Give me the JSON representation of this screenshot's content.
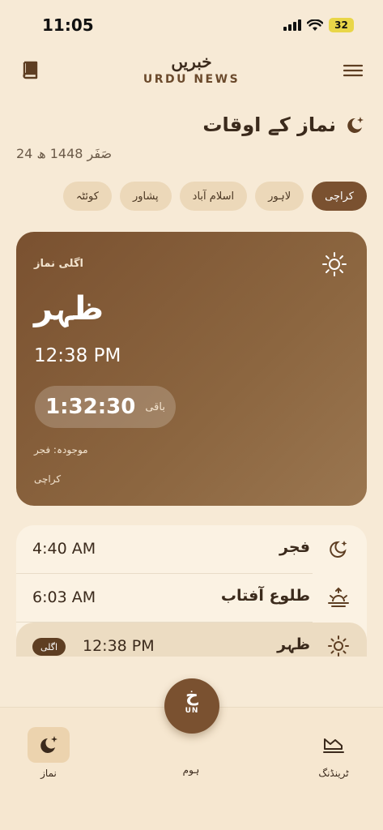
{
  "status": {
    "time": "11:05",
    "battery": "32"
  },
  "header": {
    "brand_urdu": "خبریں",
    "brand_en": "URDU NEWS"
  },
  "page": {
    "title": "نماز کے اوقات",
    "hijri_date": "24 صَفَر 1448 ھ"
  },
  "cities": [
    {
      "label": "کراچی",
      "active": true
    },
    {
      "label": "لاہور"
    },
    {
      "label": "اسلام آباد"
    },
    {
      "label": "پشاور"
    },
    {
      "label": "کوئٹہ"
    }
  ],
  "next_prayer": {
    "label": "اگلی نماز",
    "name": "ظہر",
    "time": "12:38 PM",
    "countdown": "1:32:30",
    "countdown_label": "باقی",
    "current": "موجودہ: فجر",
    "city": "کراچی"
  },
  "prayers": [
    {
      "name": "فجر",
      "time": "4:40 AM",
      "icon": "crescent-star-icon"
    },
    {
      "name": "طلوع آفتاب",
      "time": "6:03 AM",
      "icon": "sunrise-icon"
    },
    {
      "name": "ظہر",
      "time": "12:38 PM",
      "icon": "sun-icon",
      "badge": "اگلی"
    }
  ],
  "tabbar": {
    "prayer": "نماز",
    "home": "ہوم",
    "trending": "ٹرینڈنگ",
    "fab_ar": "خ",
    "fab_en": "UN"
  },
  "colors": {
    "accent": "#7a5130",
    "background": "#f7ead6",
    "chip": "#ecd8b9"
  }
}
